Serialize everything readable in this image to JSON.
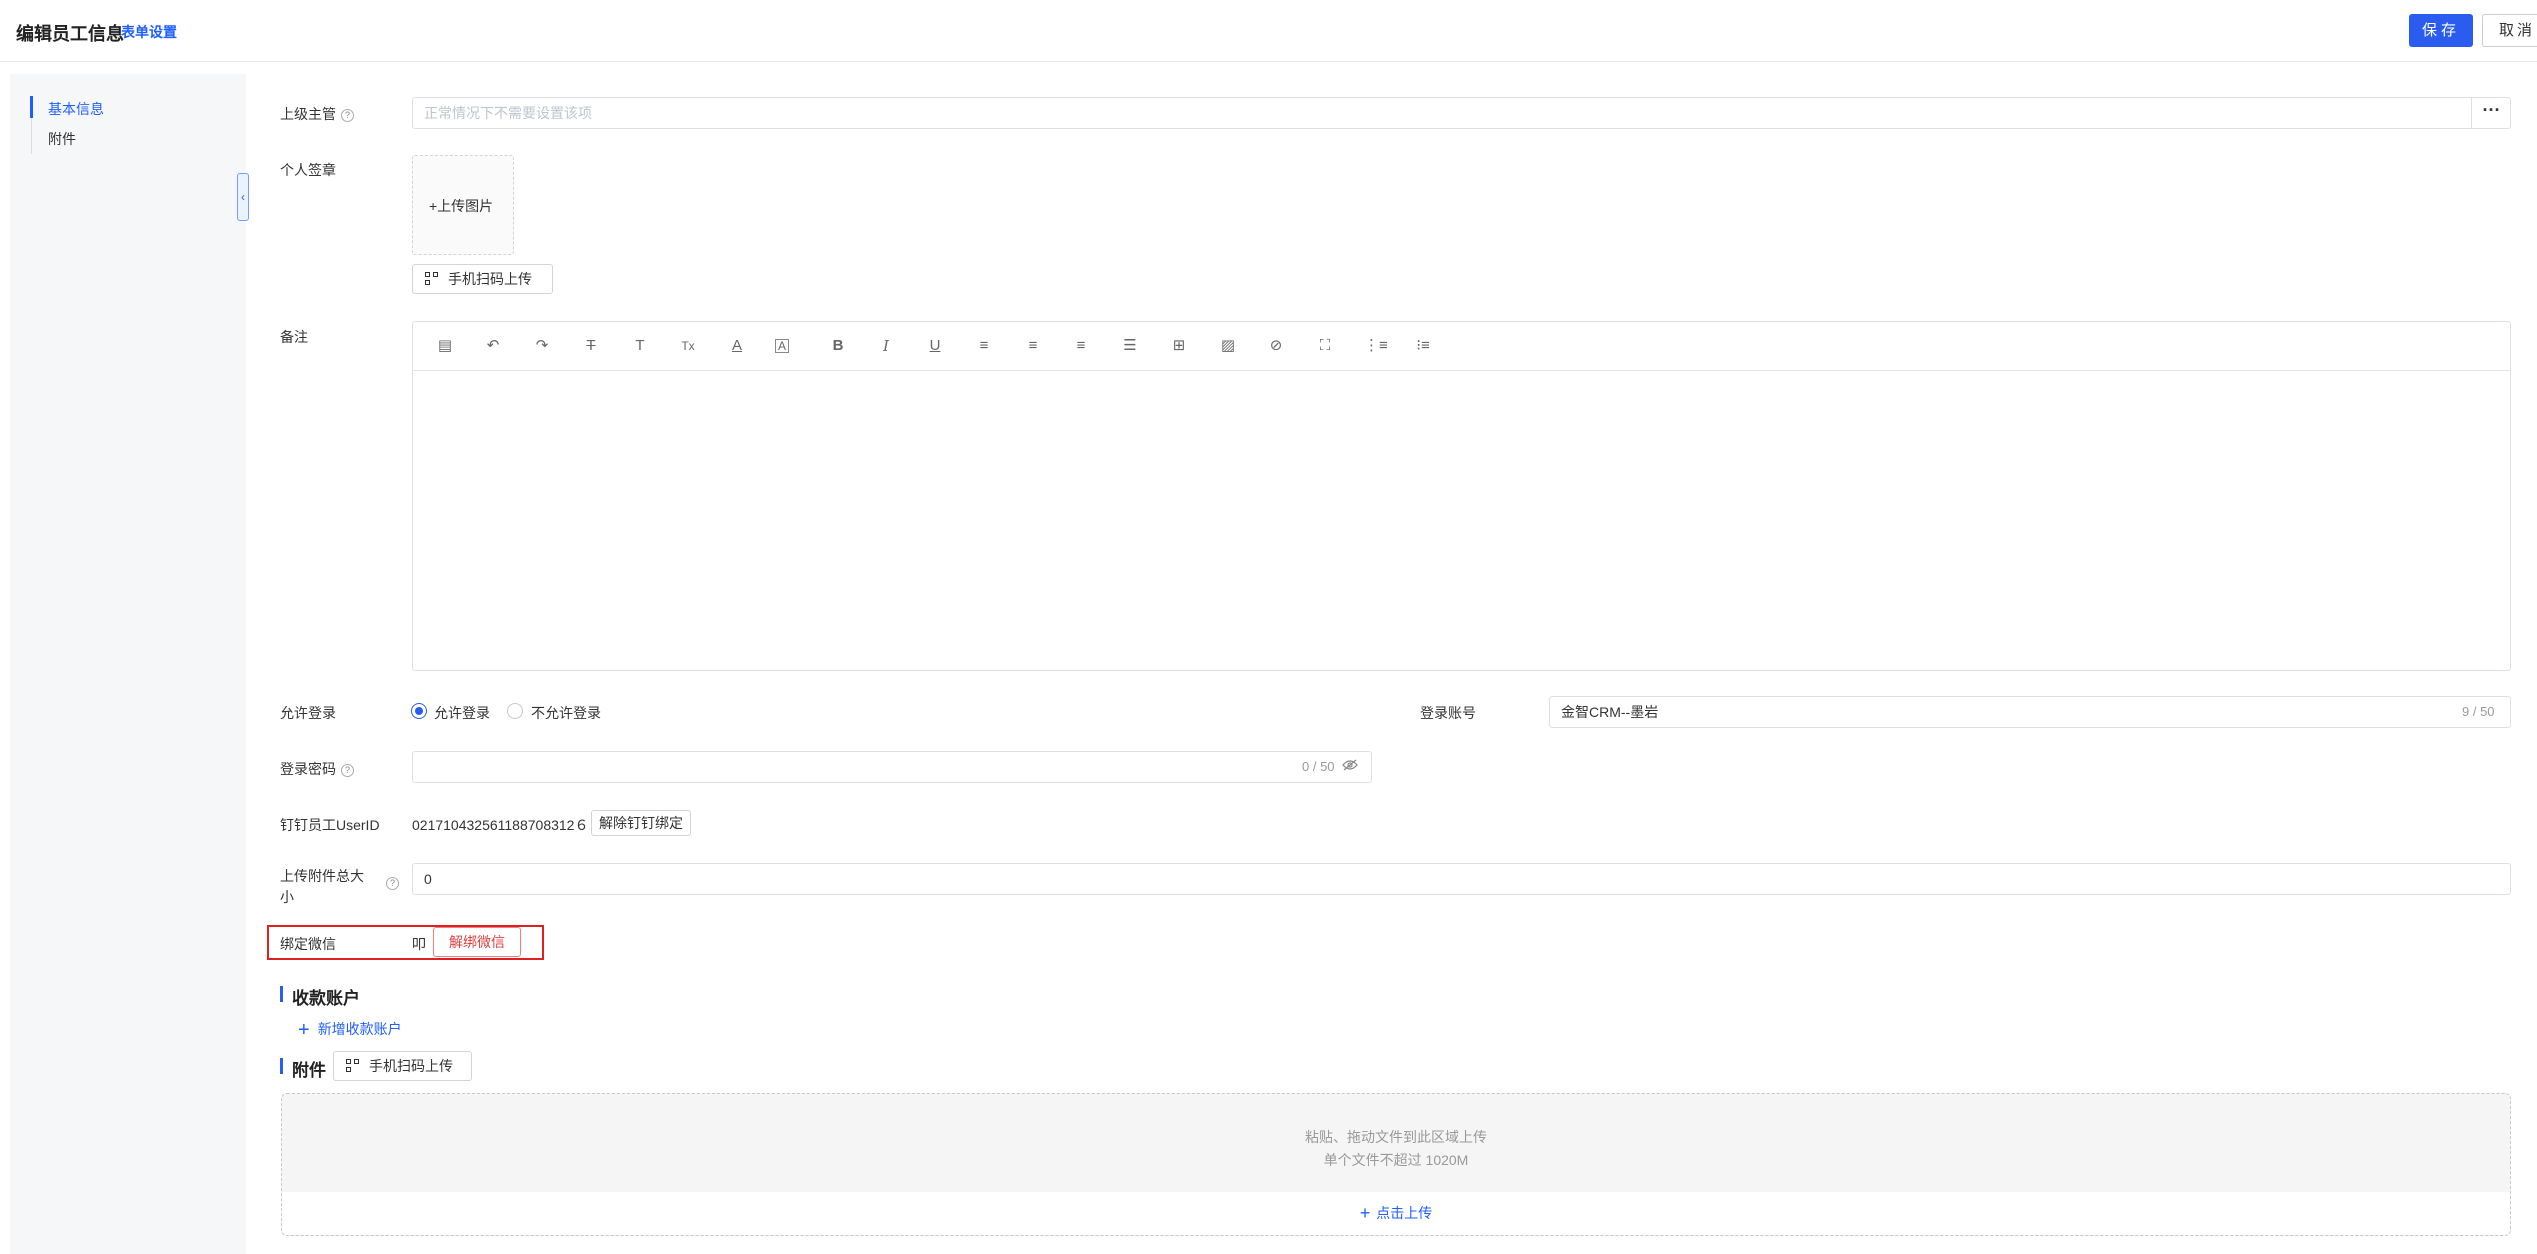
{
  "header": {
    "title": "编辑员工信息",
    "form_settings": "表单设置",
    "save_label": "保存",
    "cancel_label": "取消"
  },
  "nav": {
    "items": [
      {
        "label": "基本信息",
        "active": true
      },
      {
        "label": "附件",
        "active": false
      }
    ]
  },
  "form": {
    "supervisor": {
      "label": "上级主管",
      "placeholder": "正常情况下不需要设置该项",
      "more": "···"
    },
    "signature": {
      "label": "个人签章",
      "upload_image": "+上传图片",
      "scan_upload": "手机扫码上传"
    },
    "remark": {
      "label": "备注"
    },
    "allow_login": {
      "label": "允许登录",
      "options": [
        "允许登录",
        "不允许登录"
      ],
      "selected": "允许登录"
    },
    "login_account": {
      "label": "登录账号",
      "value": "金智CRM--墨岩",
      "counter": "9 / 50"
    },
    "login_password": {
      "label": "登录密码",
      "value": "",
      "counter": "0 / 50"
    },
    "dingtalk": {
      "label": "钉钉员工UserID",
      "value": "021710432561188708312６",
      "unbind": "解除钉钉绑定"
    },
    "attachment_total": {
      "label_line1": "上传附件总大",
      "label_line2": "小",
      "value": "0"
    },
    "wechat": {
      "label": "绑定微信",
      "value": "叩",
      "unbind": "解绑微信"
    }
  },
  "sections": {
    "accounts": {
      "title": "收款账户",
      "add": "新增收款账户"
    },
    "attachments": {
      "title": "附件",
      "scan_upload": "手机扫码上传",
      "drop_line1": "粘贴、拖动文件到此区域上传",
      "drop_line2": "单个文件不超过 1020M",
      "click_upload": "点击上传"
    }
  },
  "colors": {
    "primary": "#2b5cf0",
    "danger": "#e02020"
  }
}
